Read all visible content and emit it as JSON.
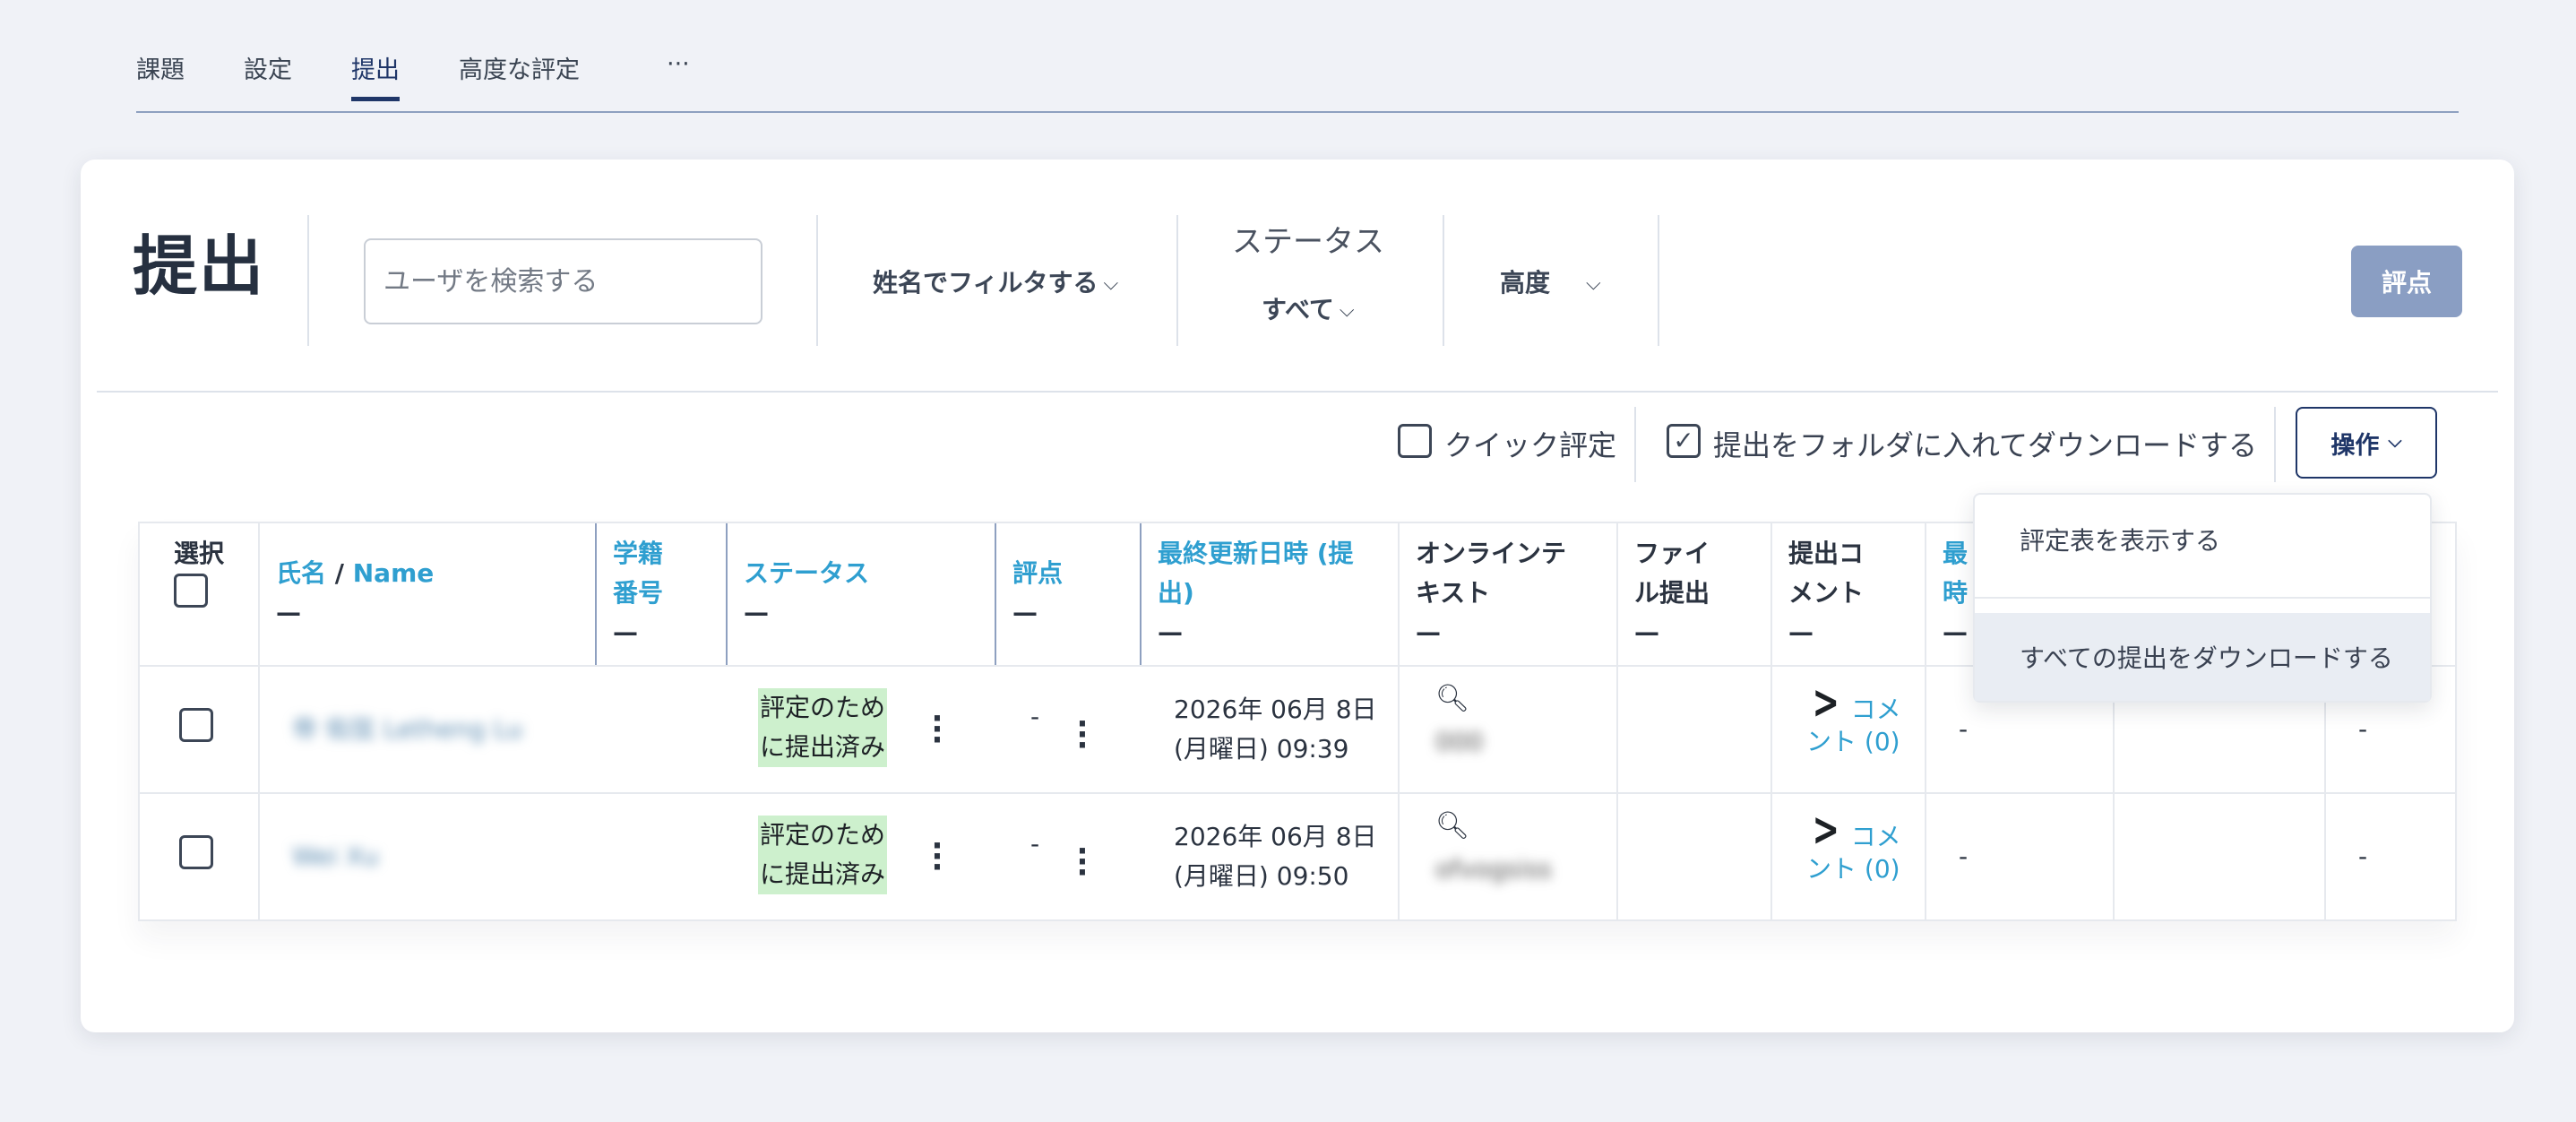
{
  "tabs": [
    {
      "label": "課題"
    },
    {
      "label": "設定"
    },
    {
      "label": "提出",
      "active": true
    },
    {
      "label": "高度な評定"
    },
    {
      "label": "···"
    }
  ],
  "header": {
    "title": "提出",
    "search_placeholder": "ユーザを検索する",
    "name_filter_label": "姓名でフィルタする",
    "status_title": "ステータス",
    "status_value": "すべて",
    "advanced_label": "高度",
    "grade_button": "評点"
  },
  "options": {
    "quick_grading": {
      "label": "クイック評定",
      "checked": false
    },
    "download_in_folders": {
      "label": "提出をフォルダに入れてダウンロードする",
      "checked": true
    },
    "actions_label": "操作"
  },
  "dropdown": {
    "items": [
      {
        "label": "評定表を表示する"
      },
      {
        "label": "すべての提出をダウンロードする",
        "highlighted": true
      }
    ]
  },
  "table": {
    "headers": {
      "select": "選択",
      "name_part1": "氏名",
      "name_sep": " / ",
      "name_part2": "Name",
      "student_id_1": "学籍",
      "student_id_2": "番号",
      "status": "ステータス",
      "grade": "評点",
      "last_modified_1": "最終更新日時 (提",
      "last_modified_2": "出)",
      "online_text_1": "オンラインテ",
      "online_text_2": "キスト",
      "file_submission_1": "ファイ",
      "file_submission_2": "ル提出",
      "submission_comments_1": "提出コ",
      "submission_comments_2": "メント",
      "more_1": "最",
      "more_2": "時",
      "dash": "—"
    },
    "rows": [
      {
        "name": "帝 佑弦 Letheng Lu",
        "status_line1": "評定のため",
        "status_line2": "に提出済み",
        "grade": "-",
        "modified_line1": "2026年 06月 8日",
        "modified_line2": "(月曜日) 09:39",
        "online_text": "000",
        "comment_line1": "コメ",
        "comment_line2": "ント (0)",
        "col_extra1": "-",
        "col_extra2": "-"
      },
      {
        "name": "Wei Xu",
        "status_line1": "評定のため",
        "status_line2": "に提出済み",
        "grade": "-",
        "modified_line1": "2026年 06月 8日",
        "modified_line2": "(月曜日) 09:50",
        "online_text": "ofvogsiss",
        "comment_line1": "コメ",
        "comment_line2": "ント (0)",
        "col_extra1": "-",
        "col_extra2": "-"
      }
    ]
  },
  "colors": {
    "accent": "#1f3668",
    "link": "#2f9fd0",
    "status_bg": "#cdf0cd",
    "grade_button_bg": "#8a9ec3"
  }
}
